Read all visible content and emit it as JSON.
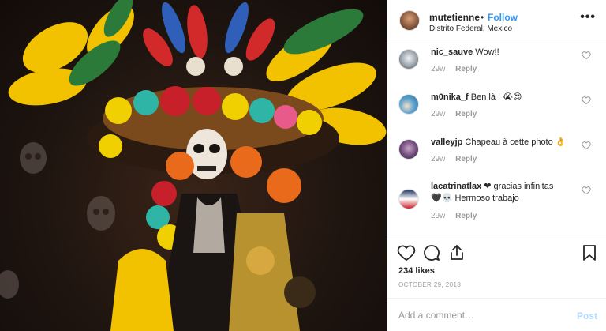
{
  "post": {
    "username": "mutetienne",
    "separator": "•",
    "follow_label": "Follow",
    "location": "Distrito Federal, Mexico",
    "more_icon": "more-horizontal-icon"
  },
  "photo": {
    "description_icon": "catrina-photo",
    "colors": {
      "background": "#1f1510",
      "feather_yellow": "#f2c200",
      "feather_green": "#2b7a3a",
      "rose_red": "#c8202a",
      "rose_orange": "#e86a1a",
      "teal": "#2fb5a5"
    }
  },
  "comments": [
    {
      "username": "nic_sauve",
      "text": "Wow!!",
      "age": "29w",
      "reply_label": "Reply"
    },
    {
      "username": "m0nika_f",
      "text": "Ben là ! 😭😍",
      "age": "29w",
      "reply_label": "Reply"
    },
    {
      "username": "valleyjp",
      "text": "Chapeau à cette photo 👌",
      "age": "29w",
      "reply_label": "Reply"
    },
    {
      "username": "lacatrinatlax",
      "text": "❤ gracias infinitas",
      "text2": "🖤💀 Hermoso trabajo",
      "age": "29w",
      "reply_label": "Reply"
    }
  ],
  "actions": {
    "like_icon": "heart-icon",
    "comment_icon": "comment-icon",
    "share_icon": "share-icon",
    "save_icon": "bookmark-icon",
    "likes": "234 likes",
    "date": "OCTOBER 29, 2018"
  },
  "add_comment": {
    "placeholder": "Add a comment…",
    "post_label": "Post"
  },
  "colors": {
    "accent": "#3897f0",
    "muted": "#999999",
    "post_disabled": "#b3dbff",
    "divider": "#efefef"
  }
}
